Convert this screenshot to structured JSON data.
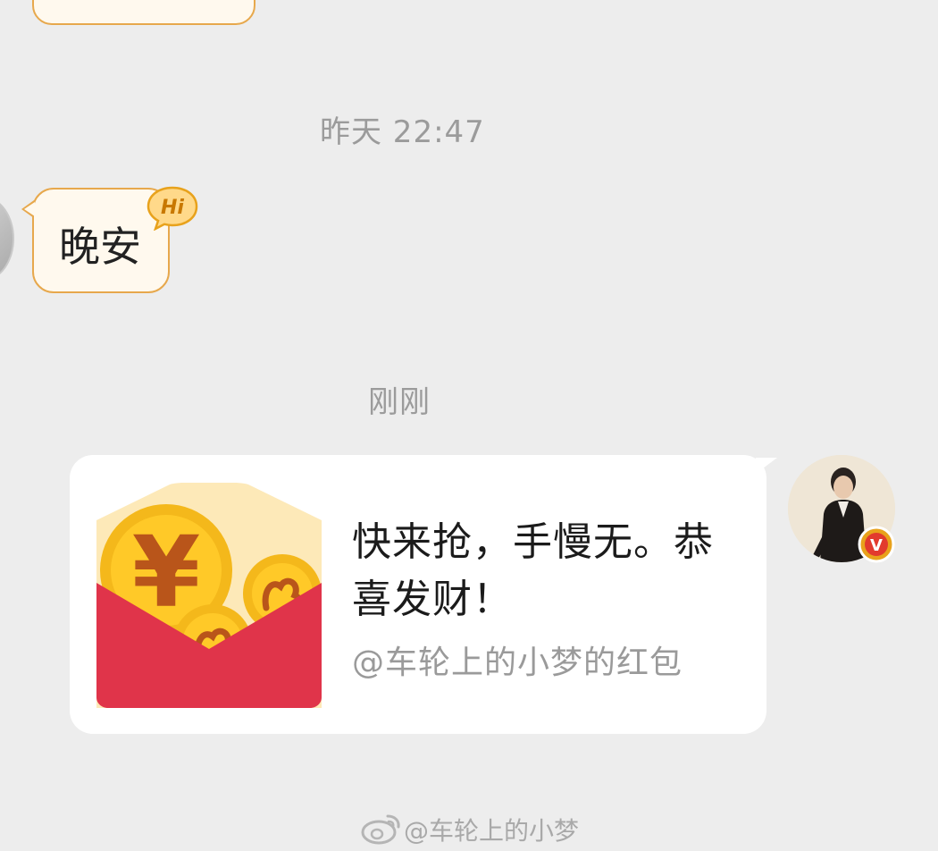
{
  "messages": {
    "timestamp_yesterday": "昨天 22:47",
    "incoming_text": "晚安",
    "hi_badge_text": "Hi",
    "timestamp_now": "刚刚"
  },
  "red_packet": {
    "title": "快来抢，手慢无。恭喜发财！",
    "subtitle": "@车轮上的小梦的红包",
    "currency_symbol": "¥",
    "icon": "red-envelope-icon"
  },
  "avatar": {
    "verified_badge_text": "V"
  },
  "watermark": {
    "text": "@车轮上的小梦",
    "icon": "weibo-logo-icon"
  },
  "colors": {
    "background": "#ededed",
    "bubble_fill": "#fff9ee",
    "bubble_border": "#e7a84c",
    "card_fill": "#ffffff",
    "red_envelope": "#e0344a",
    "coin_gold": "#f4b81b",
    "badge": "#e8a21c"
  }
}
